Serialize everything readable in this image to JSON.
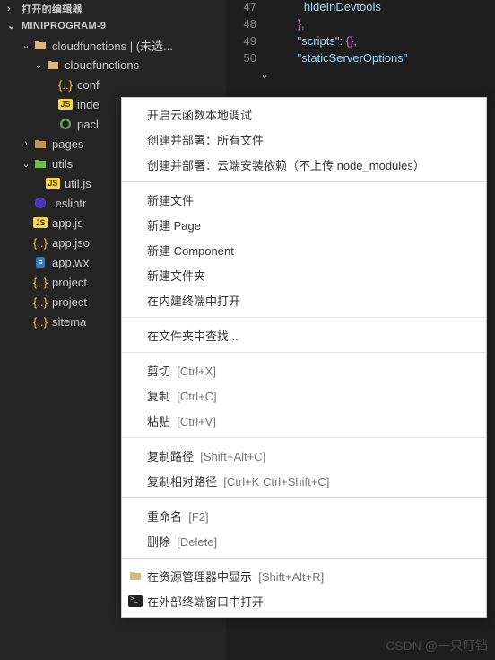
{
  "sections": {
    "openEditors": "打开的编辑器",
    "project": "MINIPROGRAM-9"
  },
  "tree": {
    "cloudfunctionsRoot": "cloudfunctions | (未选...",
    "cloudfunctions": "cloudfunctions",
    "conf": "conf",
    "index": "inde",
    "pack": "pacl",
    "pages": "pages",
    "utils": "utils",
    "utiljs": "util.js",
    "eslintrc": ".eslintr",
    "appjs": "app.js",
    "appjson": "app.jso",
    "appwxml": "app.wx",
    "project1": "project",
    "project2": "project",
    "sitemap": "sitema"
  },
  "editor": {
    "lines": [
      "47",
      "48",
      "49",
      "50"
    ],
    "code": {
      "l47": {
        "text": "hideInDevtools",
        "indent": "        "
      },
      "l48": {
        "close": "},",
        "indent": "      "
      },
      "l49": {
        "key": "scripts",
        "val": "{},",
        "indent": "      "
      },
      "l50": {
        "key": "staticServerOptions",
        "indent": "      "
      }
    }
  },
  "menu": {
    "debug": "开启云函数本地调试",
    "deployAll": "创建并部署：所有文件",
    "deployCloud": "创建并部署：云端安装依赖（不上传 node_modules）",
    "newFile": "新建文件",
    "newPage": "新建 Page",
    "newComponent": "新建 Component",
    "newFolder": "新建文件夹",
    "openTerminal": "在内建终端中打开",
    "findInFolder": "在文件夹中查找...",
    "cut": "剪切",
    "cutKey": "[Ctrl+X]",
    "copy": "复制",
    "copyKey": "[Ctrl+C]",
    "paste": "粘贴",
    "pasteKey": "[Ctrl+V]",
    "copyPath": "复制路径",
    "copyPathKey": "[Shift+Alt+C]",
    "copyRelPath": "复制相对路径",
    "copyRelPathKey": "[Ctrl+K Ctrl+Shift+C]",
    "rename": "重命名",
    "renameKey": "[F2]",
    "delete": "删除",
    "deleteKey": "[Delete]",
    "reveal": "在资源管理器中显示",
    "revealKey": "[Shift+Alt+R]",
    "externalTerminal": "在外部终端窗口中打开"
  },
  "watermark": "CSDN @一只叮铛"
}
